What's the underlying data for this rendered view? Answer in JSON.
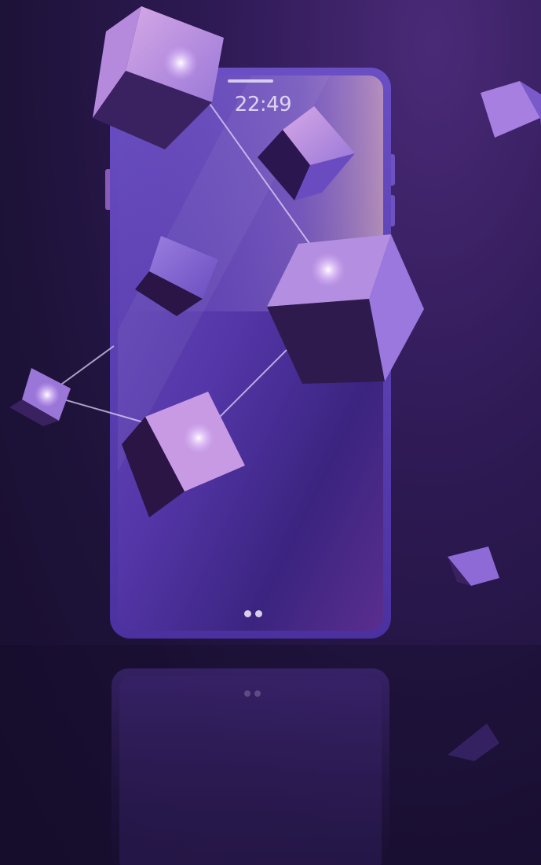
{
  "phone": {
    "clock_time": "22:49",
    "page_indicator_count": 2
  },
  "colors": {
    "background_dark": "#1d1238",
    "background_light": "#4a2a78",
    "phone_frame": "#5b3fb0",
    "screen": "#5a3aa8",
    "cube_light": "#c89ae0",
    "cube_dark": "#2a1645",
    "connection_line": "#e8d8ff"
  },
  "icons": [
    "cube-icon",
    "glowing-node-icon"
  ]
}
